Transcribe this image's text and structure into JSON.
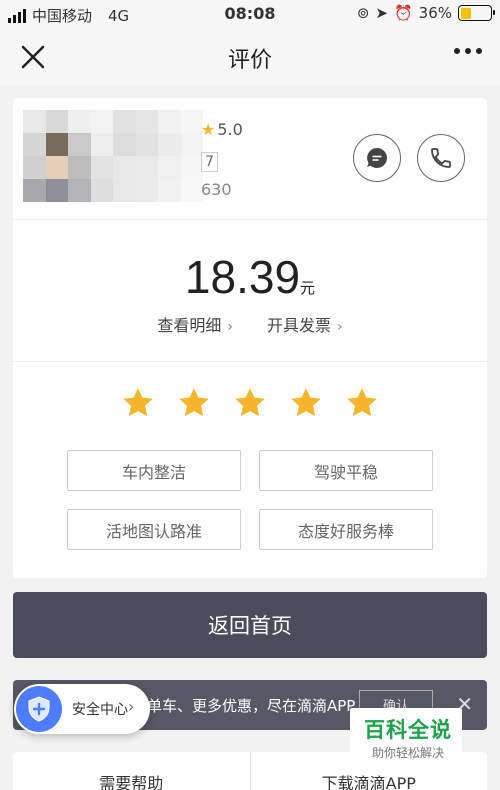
{
  "status_bar": {
    "carrier": "中国移动",
    "network": "4G",
    "time": "08:08",
    "battery": "36%",
    "battery_level": 0.36
  },
  "nav": {
    "title": "评价"
  },
  "driver": {
    "rating": "5.0",
    "tag": "7",
    "orders": "630"
  },
  "fare": {
    "amount": "18.39",
    "unit": "元",
    "details_link": "查看明细",
    "invoice_link": "开具发票"
  },
  "rating_stars": {
    "selected": 5,
    "total": 5,
    "color": "#f7b52b"
  },
  "tags": [
    "车内整洁",
    "驾驶平稳",
    "活地图认路准",
    "态度好服务棒"
  ],
  "home_button": "返回首页",
  "banner": {
    "text": "单车、更多优惠，尽在滴滴APP",
    "confirm": "确认"
  },
  "safety_center": {
    "label": "安全中心"
  },
  "bottom_bar": {
    "help": "需要帮助",
    "download": "下载滴滴APP"
  },
  "watermark": {
    "title": "百科全说",
    "subtitle": "助你轻松解决"
  },
  "colors": {
    "accent_dark": "#4a4c5c",
    "star": "#f7b52b",
    "shield": "#4d7dfc",
    "watermark_green": "#1aa34a"
  }
}
